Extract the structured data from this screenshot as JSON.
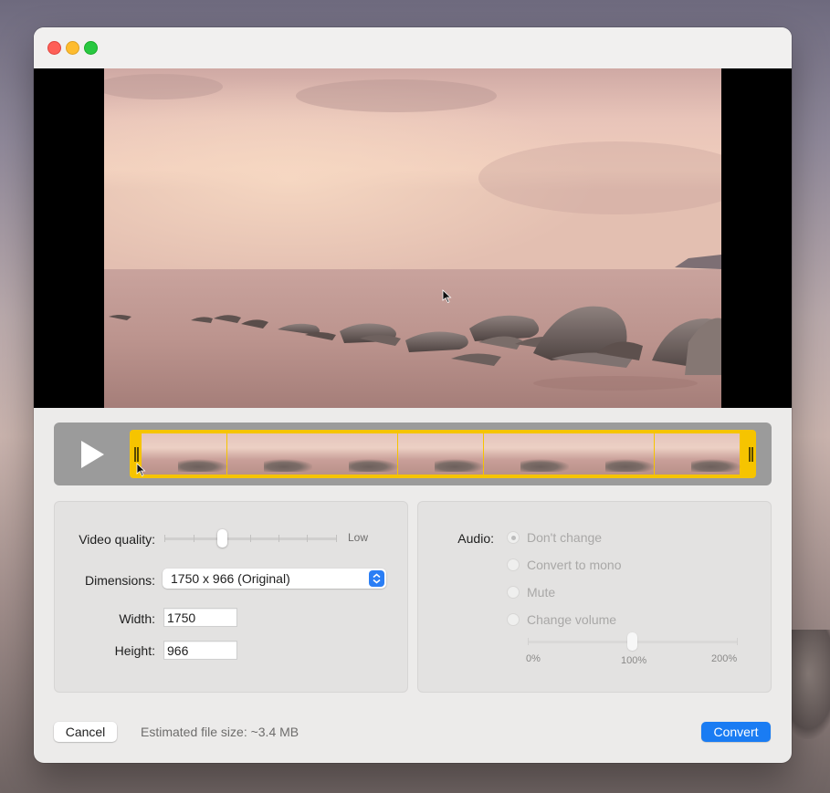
{
  "window": {
    "controls": [
      "close",
      "minimize",
      "zoom"
    ]
  },
  "player": {
    "play_icon": "play-icon",
    "thumbnail_count": 7
  },
  "video_settings": {
    "quality_label": "Video quality:",
    "quality_low_label": "Low",
    "quality_level_fraction": 0.33,
    "dimensions_label": "Dimensions:",
    "dimensions_value": "1750 x 966  (Original)",
    "width_label": "Width:",
    "width_value": "1750",
    "height_label": "Height:",
    "height_value": "966"
  },
  "audio_settings": {
    "audio_label": "Audio:",
    "options": [
      "Don't change",
      "Convert to mono",
      "Mute",
      "Change volume"
    ],
    "selected_option": "Don't change",
    "volume_ticks": [
      "0%",
      "100%",
      "200%"
    ],
    "volume_percent": 100
  },
  "footer": {
    "cancel_label": "Cancel",
    "status_text": "Estimated file size: ~3.4 MB",
    "convert_label": "Convert"
  },
  "colors": {
    "accent": "#1a7cf3",
    "trim_highlight": "#f6c400",
    "close": "#fe5f57",
    "minimize": "#febc2e",
    "zoom": "#28c840"
  }
}
